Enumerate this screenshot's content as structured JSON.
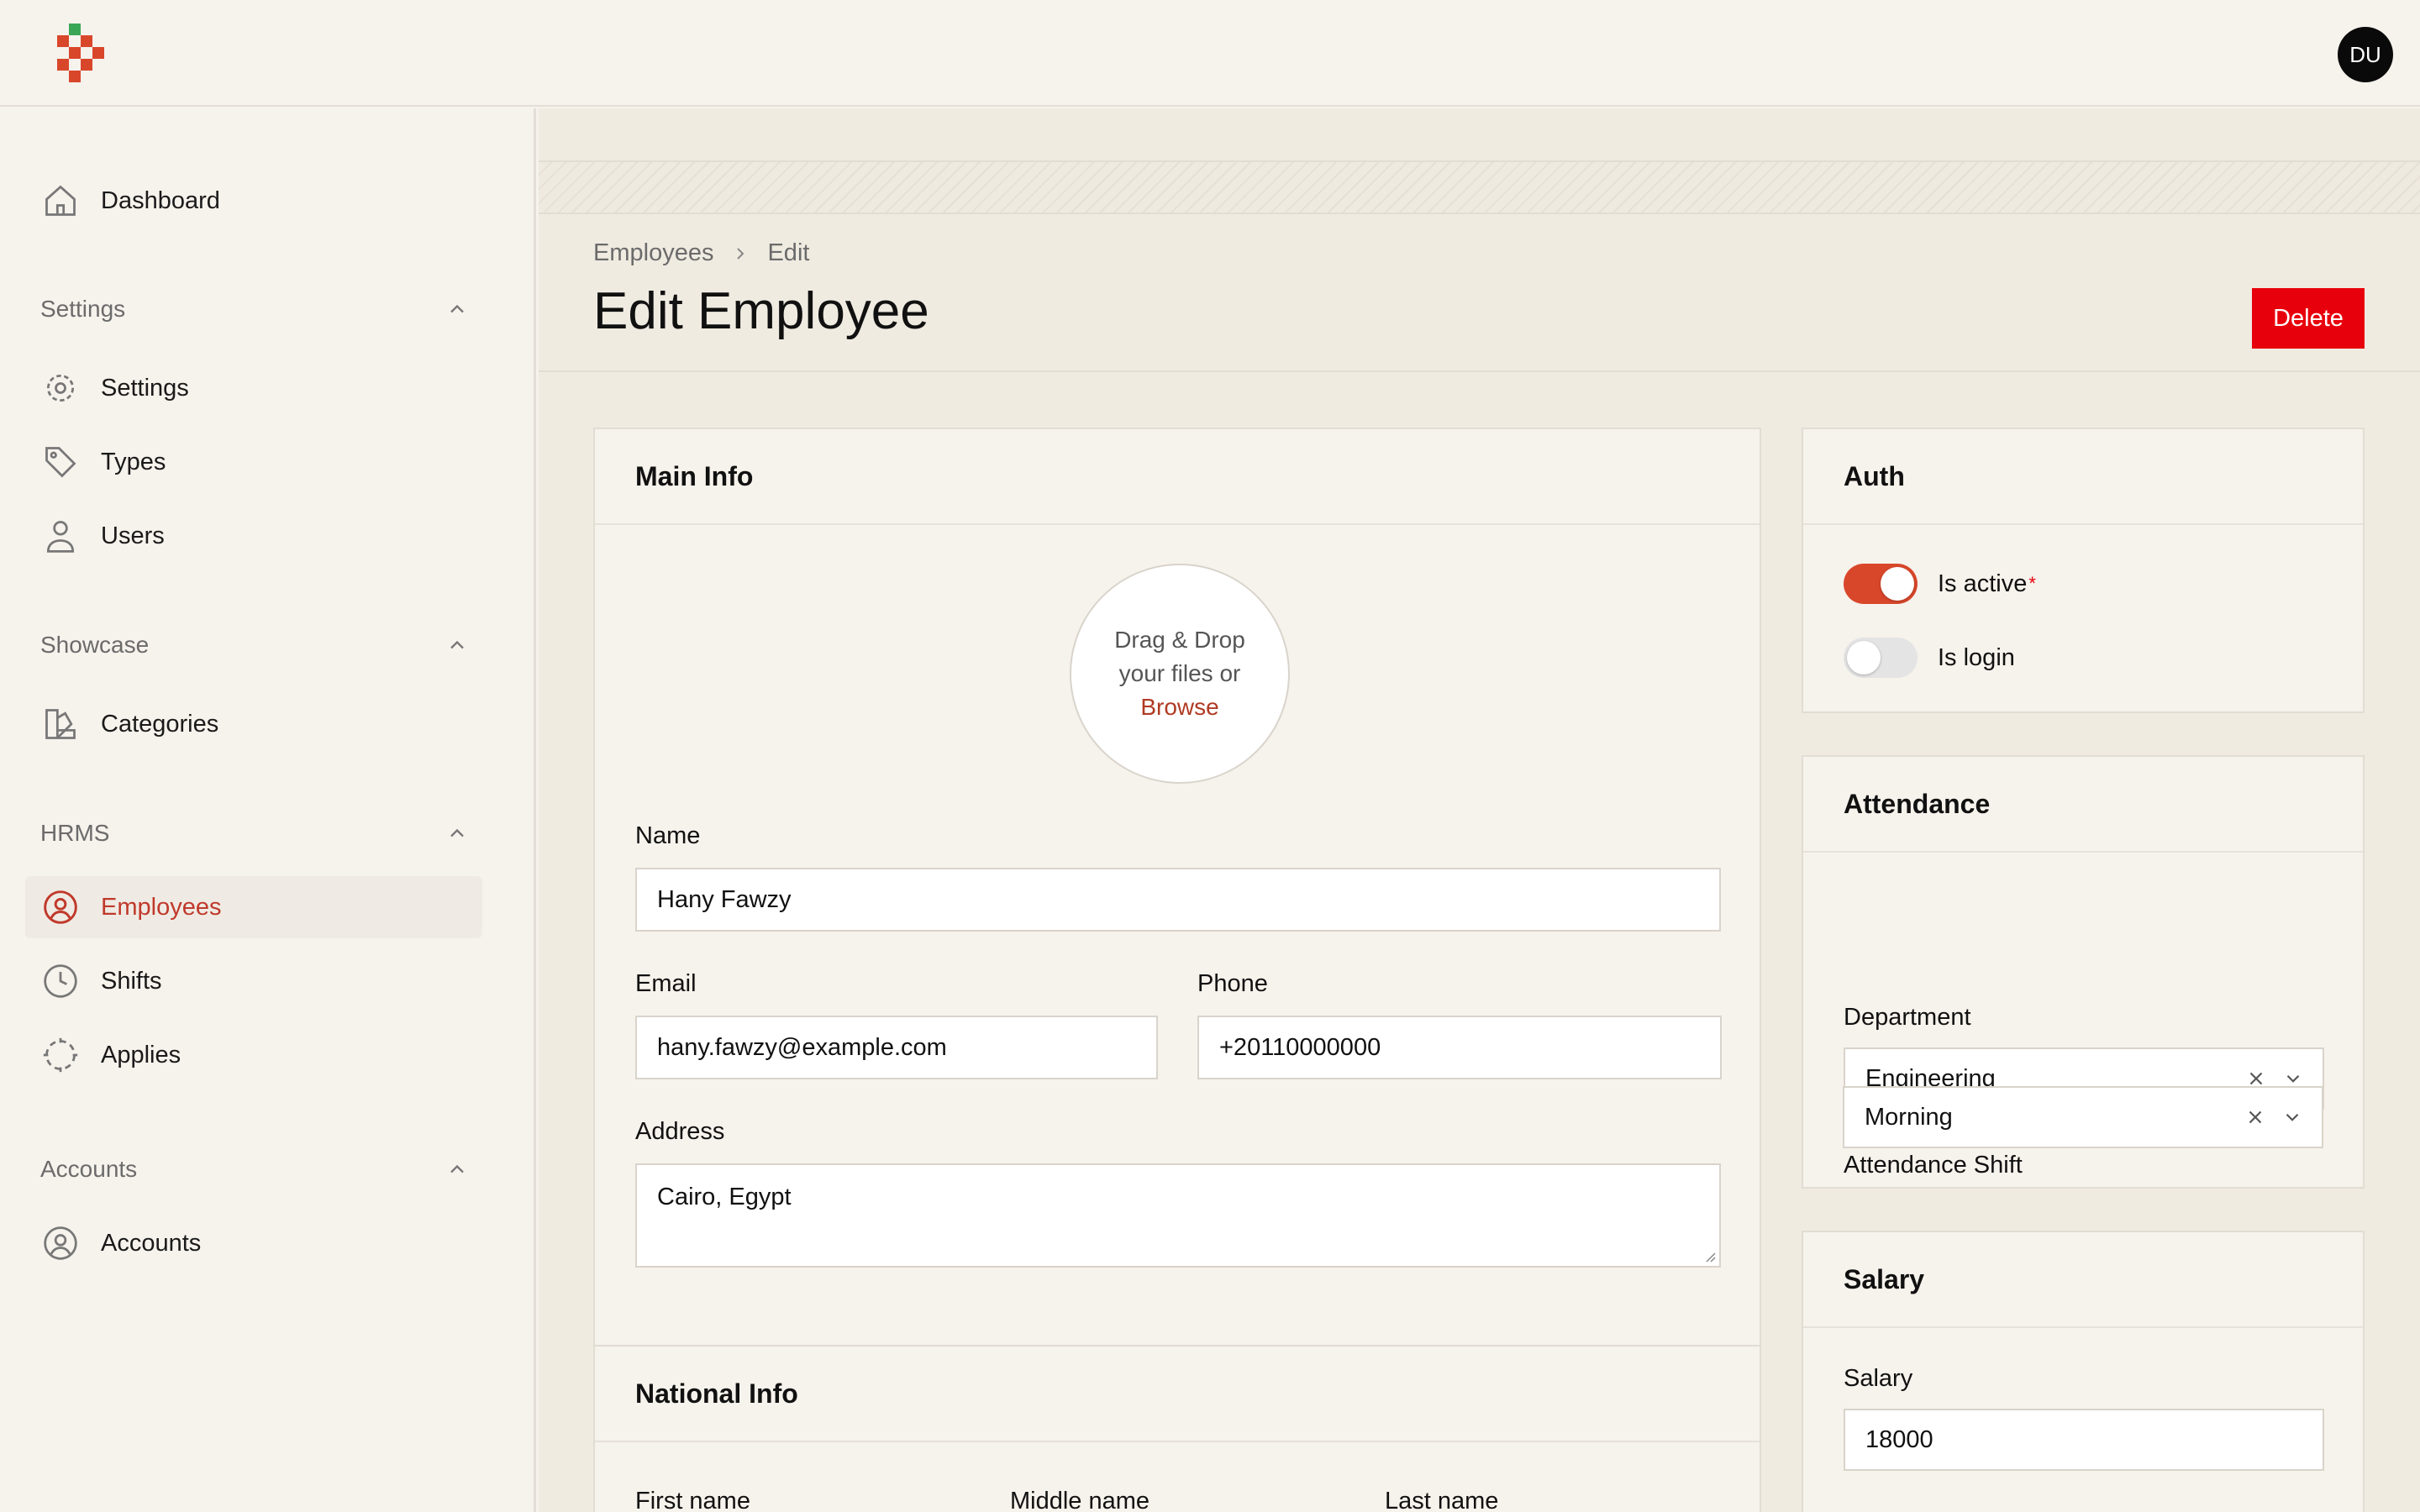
{
  "header": {
    "avatar_initials": "DU"
  },
  "sidebar": {
    "dashboard": "Dashboard",
    "sections": {
      "settings": "Settings",
      "showcase": "Showcase",
      "hrms": "HRMS",
      "accounts": "Accounts"
    },
    "items": {
      "settings": "Settings",
      "types": "Types",
      "users": "Users",
      "categories": "Categories",
      "employees": "Employees",
      "shifts": "Shifts",
      "applies": "Applies",
      "accounts": "Accounts"
    },
    "active_item": "Employees"
  },
  "page": {
    "breadcrumb": [
      "Employees",
      "Edit"
    ],
    "title": "Edit Employee",
    "delete_label": "Delete"
  },
  "main_info": {
    "title": "Main Info",
    "dropzone_line1": "Drag & Drop",
    "dropzone_line2": "your files or",
    "dropzone_browse": "Browse",
    "name_label": "Name",
    "name_value": "Hany Fawzy",
    "email_label": "Email",
    "email_value": "hany.fawzy@example.com",
    "phone_label": "Phone",
    "phone_value": "+20110000000",
    "address_label": "Address",
    "address_value": "Cairo, Egypt"
  },
  "national_info": {
    "title": "National Info",
    "first_name_label": "First name",
    "middle_name_label": "Middle name",
    "last_name_label": "Last name"
  },
  "auth": {
    "title": "Auth",
    "is_active_label": "Is active",
    "is_active": true,
    "is_active_required": "*",
    "is_login_label": "Is login",
    "is_login": false
  },
  "attendance": {
    "title": "Attendance",
    "department_label": "Department",
    "department_value": "Engineering",
    "shift_label": "Attendance Shift",
    "shift_value": "Morning"
  },
  "salary": {
    "title": "Salary",
    "salary_label": "Salary",
    "salary_value": "18000"
  },
  "colors": {
    "accent": "#d9472b",
    "danger": "#e7000b",
    "active_nav": "#c0392b"
  }
}
